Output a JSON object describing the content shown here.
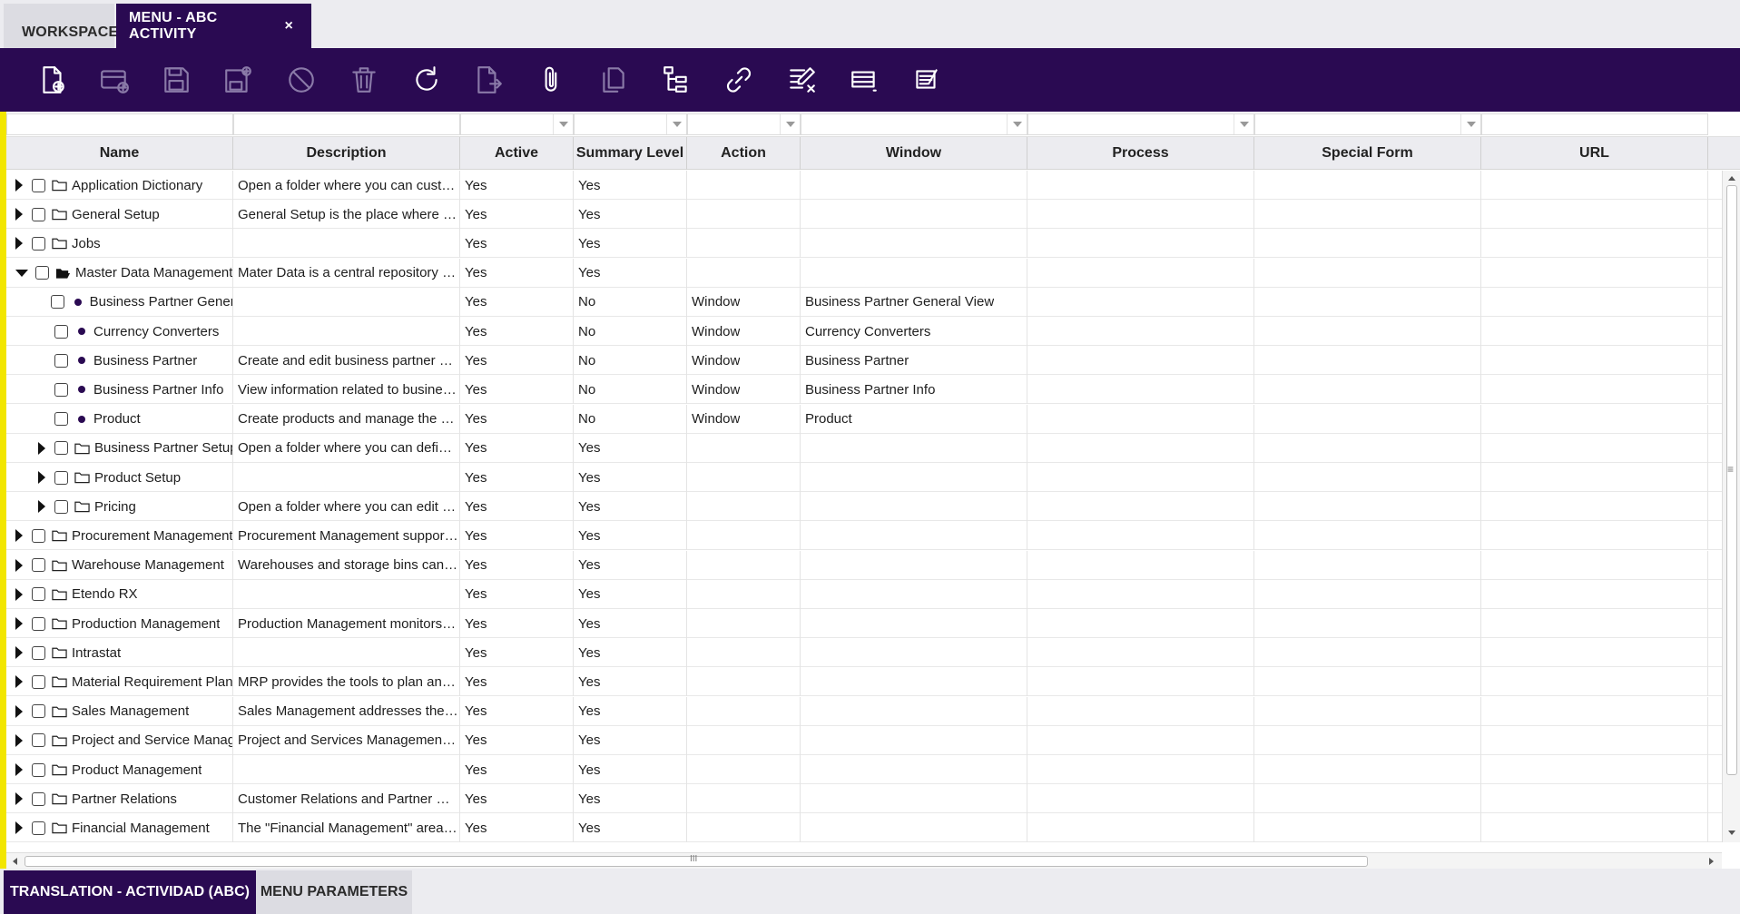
{
  "top_tabs": {
    "workspace": "WORKSPACE",
    "menu": "MENU - ABC ACTIVITY",
    "close_glyph": "×"
  },
  "toolbar": {
    "buttons": [
      {
        "icon": "new-document-icon",
        "enabled": true
      },
      {
        "icon": "new-record-icon",
        "enabled": false
      },
      {
        "icon": "save-icon",
        "enabled": false
      },
      {
        "icon": "save-and-new-icon",
        "enabled": false
      },
      {
        "icon": "cancel-icon",
        "enabled": false
      },
      {
        "icon": "delete-icon",
        "enabled": false
      },
      {
        "icon": "refresh-icon",
        "enabled": true
      },
      {
        "icon": "export-icon",
        "enabled": false
      },
      {
        "icon": "attachment-icon",
        "enabled": true
      },
      {
        "icon": "clone-icon",
        "enabled": false
      },
      {
        "icon": "tree-icon",
        "enabled": true
      },
      {
        "icon": "link-icon",
        "enabled": true
      },
      {
        "icon": "audit-trail-icon",
        "enabled": true
      },
      {
        "icon": "grid-view-icon",
        "enabled": true
      },
      {
        "icon": "notes-icon",
        "enabled": true
      }
    ]
  },
  "grid": {
    "columns": [
      {
        "key": "name",
        "label": "Name"
      },
      {
        "key": "description",
        "label": "Description"
      },
      {
        "key": "active",
        "label": "Active"
      },
      {
        "key": "summary",
        "label": "Summary Level"
      },
      {
        "key": "action",
        "label": "Action"
      },
      {
        "key": "window",
        "label": "Window"
      },
      {
        "key": "process",
        "label": "Process"
      },
      {
        "key": "special_form",
        "label": "Special Form"
      },
      {
        "key": "url",
        "label": "URL"
      }
    ],
    "rows": [
      {
        "level": 0,
        "toggle": "closed",
        "icon": "folder",
        "name": "Application Dictionary",
        "description": "Open a folder where you can customize the application",
        "active": "Yes",
        "summary": "Yes",
        "action": "",
        "window": ""
      },
      {
        "level": 0,
        "toggle": "closed",
        "icon": "folder",
        "name": "General Setup",
        "description": "General Setup is the place where you can configure",
        "active": "Yes",
        "summary": "Yes",
        "action": "",
        "window": ""
      },
      {
        "level": 0,
        "toggle": "closed",
        "icon": "folder",
        "name": "Jobs",
        "description": "",
        "active": "Yes",
        "summary": "Yes",
        "action": "",
        "window": ""
      },
      {
        "level": 0,
        "toggle": "open",
        "icon": "folder-open",
        "name": "Master Data Management",
        "description": "Mater Data is a central repository of data",
        "active": "Yes",
        "summary": "Yes",
        "action": "",
        "window": ""
      },
      {
        "level": 1,
        "toggle": "none",
        "icon": "dot",
        "name": "Business Partner General View",
        "description": "",
        "active": "Yes",
        "summary": "No",
        "action": "Window",
        "window": "Business Partner General View"
      },
      {
        "level": 1,
        "toggle": "none",
        "icon": "dot",
        "name": "Currency Converters",
        "description": "",
        "active": "Yes",
        "summary": "No",
        "action": "Window",
        "window": "Currency Converters"
      },
      {
        "level": 1,
        "toggle": "none",
        "icon": "dot",
        "name": "Business Partner",
        "description": "Create and edit business partner data",
        "active": "Yes",
        "summary": "No",
        "action": "Window",
        "window": "Business Partner"
      },
      {
        "level": 1,
        "toggle": "none",
        "icon": "dot",
        "name": "Business Partner Info",
        "description": "View information related to business partners",
        "active": "Yes",
        "summary": "No",
        "action": "Window",
        "window": "Business Partner Info"
      },
      {
        "level": 1,
        "toggle": "none",
        "icon": "dot",
        "name": "Product",
        "description": "Create products and manage the catalog",
        "active": "Yes",
        "summary": "No",
        "action": "Window",
        "window": "Product"
      },
      {
        "level": 1,
        "toggle": "closed",
        "icon": "folder",
        "name": "Business Partner Setup",
        "description": "Open a folder where you can define setup",
        "active": "Yes",
        "summary": "Yes",
        "action": "",
        "window": ""
      },
      {
        "level": 1,
        "toggle": "closed",
        "icon": "folder",
        "name": "Product Setup",
        "description": "",
        "active": "Yes",
        "summary": "Yes",
        "action": "",
        "window": ""
      },
      {
        "level": 1,
        "toggle": "closed",
        "icon": "folder",
        "name": "Pricing",
        "description": "Open a folder where you can edit pricing",
        "active": "Yes",
        "summary": "Yes",
        "action": "",
        "window": ""
      },
      {
        "level": 0,
        "toggle": "closed",
        "icon": "folder",
        "name": "Procurement Management",
        "description": "Procurement Management supports the process",
        "active": "Yes",
        "summary": "Yes",
        "action": "",
        "window": ""
      },
      {
        "level": 0,
        "toggle": "closed",
        "icon": "folder",
        "name": "Warehouse Management",
        "description": "Warehouses and storage bins can be defined",
        "active": "Yes",
        "summary": "Yes",
        "action": "",
        "window": ""
      },
      {
        "level": 0,
        "toggle": "closed",
        "icon": "folder",
        "name": "Etendo RX",
        "description": "",
        "active": "Yes",
        "summary": "Yes",
        "action": "",
        "window": ""
      },
      {
        "level": 0,
        "toggle": "closed",
        "icon": "folder",
        "name": "Production Management",
        "description": "Production Management monitors the process",
        "active": "Yes",
        "summary": "Yes",
        "action": "",
        "window": ""
      },
      {
        "level": 0,
        "toggle": "closed",
        "icon": "folder",
        "name": "Intrastat",
        "description": "",
        "active": "Yes",
        "summary": "Yes",
        "action": "",
        "window": ""
      },
      {
        "level": 0,
        "toggle": "closed",
        "icon": "folder",
        "name": "Material Requirement Planning",
        "description": "MRP provides the tools to plan and manage",
        "active": "Yes",
        "summary": "Yes",
        "action": "",
        "window": ""
      },
      {
        "level": 0,
        "toggle": "closed",
        "icon": "folder",
        "name": "Sales Management",
        "description": "Sales Management  addresses the process",
        "active": "Yes",
        "summary": "Yes",
        "action": "",
        "window": ""
      },
      {
        "level": 0,
        "toggle": "closed",
        "icon": "folder",
        "name": "Project and Service Management",
        "description": "Project and Services Management covers",
        "active": "Yes",
        "summary": "Yes",
        "action": "",
        "window": ""
      },
      {
        "level": 0,
        "toggle": "closed",
        "icon": "folder",
        "name": "Product Management",
        "description": "",
        "active": "Yes",
        "summary": "Yes",
        "action": "",
        "window": ""
      },
      {
        "level": 0,
        "toggle": "closed",
        "icon": "folder",
        "name": "Partner Relations",
        "description": "Customer Relations and Partner management",
        "active": "Yes",
        "summary": "Yes",
        "action": "",
        "window": ""
      },
      {
        "level": 0,
        "toggle": "closed",
        "icon": "folder",
        "name": "Financial Management",
        "description": "The \"Financial Management\" area covers",
        "active": "Yes",
        "summary": "Yes",
        "action": "",
        "window": ""
      }
    ]
  },
  "scrollbar": {
    "grip_glyph": "≡",
    "h_grip_glyph": "III"
  },
  "bottom_tabs": {
    "translation": "TRANSLATION - ACTIVIDAD (ABC)",
    "parameters": "MENU PARAMETERS"
  },
  "colors": {
    "brand": "#2a0a52",
    "accent": "#f2e600"
  }
}
